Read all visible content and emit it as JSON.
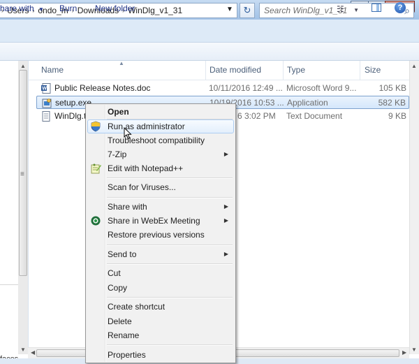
{
  "window": {
    "title": ""
  },
  "address": {
    "crumbs": [
      "Users",
      "ondo_m",
      "Downloads",
      "WinDlg_v1_31"
    ],
    "leading_sep": "›",
    "sep": "›",
    "search_placeholder": "Search WinDlg_v1_31"
  },
  "toolbar": {
    "share_with": "hare with",
    "burn": "Burn",
    "new_folder": "New folder"
  },
  "columns": {
    "name": "Name",
    "date": "Date modified",
    "type": "Type",
    "size": "Size"
  },
  "files": [
    {
      "name": "Public Release Notes.doc",
      "date": "10/11/2016 12:49 ...",
      "type": "Microsoft Word 9...",
      "size": "105 KB",
      "icon": "word-doc-icon"
    },
    {
      "name": "setup.exe",
      "date": "10/19/2016 10:53 ...",
      "type": "Application",
      "size": "582 KB",
      "icon": "installer-icon"
    },
    {
      "name": "WinDlg.t",
      "date": "6 3:02 PM",
      "type": "Text Document",
      "size": "9 KB",
      "icon": "text-file-icon"
    }
  ],
  "nav_fragment": "faces",
  "context_menu": {
    "items": [
      {
        "label": "Open",
        "bold": true
      },
      {
        "label": "Run as administrator",
        "icon": "uac-shield-icon",
        "hover": true
      },
      {
        "label": "Troubleshoot compatibility"
      },
      {
        "label": "7-Zip",
        "submenu": true
      },
      {
        "label": "Edit with Notepad++",
        "icon": "notepad-plus-plus-icon"
      },
      {
        "label": "Scan for Viruses..."
      },
      {
        "label": "Share with",
        "submenu": true
      },
      {
        "label": "Share in WebEx Meeting",
        "icon": "webex-icon",
        "submenu": true
      },
      {
        "label": "Restore previous versions"
      },
      {
        "label": "Send to",
        "submenu": true
      },
      {
        "label": "Cut"
      },
      {
        "label": "Copy"
      },
      {
        "label": "Create shortcut"
      },
      {
        "label": "Delete"
      },
      {
        "label": "Rename"
      },
      {
        "label": "Properties"
      }
    ]
  },
  "colors": {
    "selection_border": "#7da2ce",
    "menu_bg": "#f1f1f1",
    "toolbar_text": "#1e3287"
  }
}
